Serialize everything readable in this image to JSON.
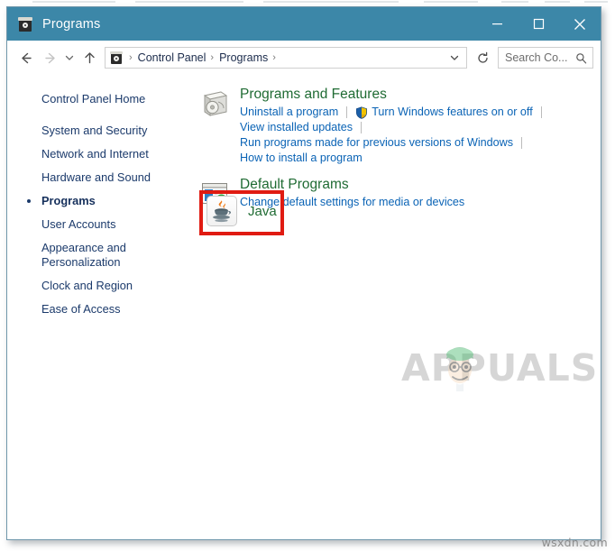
{
  "window": {
    "title": "Programs",
    "icon": "control-panel-icon",
    "controls": {
      "minimize": "–",
      "maximize": "□",
      "close": "✕"
    },
    "titlebar_color": "#3c87a8"
  },
  "toolbar": {
    "back_tooltip": "Back",
    "forward_tooltip": "Forward",
    "recent_tooltip": "Recent locations",
    "up_tooltip": "Up",
    "refresh_tooltip": "Refresh"
  },
  "address": {
    "icon": "control-panel-icon",
    "segments": [
      "Control Panel",
      "Programs"
    ],
    "separator": "›",
    "trailing_separator": "›",
    "dropdown_icon": "chevron-down-icon"
  },
  "search": {
    "placeholder": "Search Co...",
    "icon": "search-icon"
  },
  "sidebar": {
    "home": "Control Panel Home",
    "items": [
      {
        "label": "System and Security",
        "active": false
      },
      {
        "label": "Network and Internet",
        "active": false
      },
      {
        "label": "Hardware and Sound",
        "active": false
      },
      {
        "label": "Programs",
        "active": true
      },
      {
        "label": "User Accounts",
        "active": false
      },
      {
        "label": "Appearance and Personalization",
        "active": false
      },
      {
        "label": "Clock and Region",
        "active": false
      },
      {
        "label": "Ease of Access",
        "active": false
      }
    ]
  },
  "content": {
    "categories": [
      {
        "title": "Programs and Features",
        "icon": "programs-features-icon",
        "lines": [
          [
            {
              "text": "Uninstall a program",
              "shield": false
            },
            {
              "text": "Turn Windows features on or off",
              "shield": true
            }
          ],
          [
            {
              "text": "View installed updates",
              "shield": false
            }
          ],
          [
            {
              "text": "Run programs made for previous versions of Windows",
              "shield": false
            }
          ],
          [
            {
              "text": "How to install a program",
              "shield": false
            }
          ]
        ]
      },
      {
        "title": "Default Programs",
        "icon": "default-programs-icon",
        "lines": [
          [
            {
              "text": "Change default settings for media or devices",
              "shield": false
            }
          ]
        ]
      }
    ],
    "java": {
      "label": "Java",
      "icon": "java-icon",
      "highlight_color": "#e01b12"
    }
  },
  "watermarks": {
    "brand": "APPUALS",
    "site": "wsxdn.com"
  },
  "colors": {
    "title_green": "#1f6b33",
    "link_blue": "#0a63b5",
    "sidebar_blue": "#1b3a6b",
    "accent_red": "#e01b12",
    "titlebar": "#3c87a8"
  }
}
